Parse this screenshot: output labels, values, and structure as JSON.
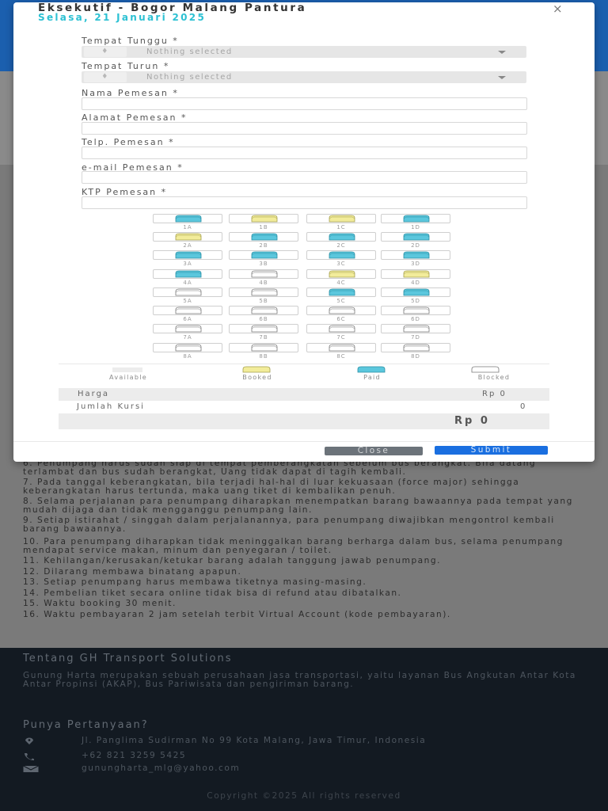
{
  "modal": {
    "title": "Eksekutif - Bogor Malang Pantura",
    "date": "Selasa, 21 Januari 2025",
    "close_icon": "×",
    "fields": {
      "pickup": {
        "label": "Tempat Tunggu *",
        "value": "Nothing selected"
      },
      "dropoff": {
        "label": "Tempat Turun *",
        "value": "Nothing selected"
      },
      "name": {
        "label": "Nama Pemesan *",
        "value": ""
      },
      "address": {
        "label": "Alamat Pemesan *",
        "value": ""
      },
      "phone": {
        "label": "Telp. Pemesan *",
        "value": ""
      },
      "email": {
        "label": "e-mail Pemesan *",
        "value": ""
      },
      "ktp": {
        "label": "KTP Pemesan *",
        "value": ""
      }
    },
    "seats": [
      {
        "id": "1A",
        "status": "paid"
      },
      {
        "id": "1B",
        "status": "booked"
      },
      {
        "id": "1C",
        "status": "booked"
      },
      {
        "id": "1D",
        "status": "paid"
      },
      {
        "id": "2A",
        "status": "booked"
      },
      {
        "id": "2B",
        "status": "paid"
      },
      {
        "id": "2C",
        "status": "paid"
      },
      {
        "id": "2D",
        "status": "paid"
      },
      {
        "id": "3A",
        "status": "paid"
      },
      {
        "id": "3B",
        "status": "paid"
      },
      {
        "id": "3C",
        "status": "paid"
      },
      {
        "id": "3D",
        "status": "paid"
      },
      {
        "id": "4A",
        "status": "paid"
      },
      {
        "id": "4B",
        "status": "available"
      },
      {
        "id": "4C",
        "status": "booked"
      },
      {
        "id": "4D",
        "status": "booked"
      },
      {
        "id": "5A",
        "status": "available"
      },
      {
        "id": "5B",
        "status": "available"
      },
      {
        "id": "5C",
        "status": "paid"
      },
      {
        "id": "5D",
        "status": "paid"
      },
      {
        "id": "6A",
        "status": "available"
      },
      {
        "id": "6B",
        "status": "available"
      },
      {
        "id": "6C",
        "status": "available"
      },
      {
        "id": "6D",
        "status": "available"
      },
      {
        "id": "7A",
        "status": "available"
      },
      {
        "id": "7B",
        "status": "available"
      },
      {
        "id": "7C",
        "status": "available"
      },
      {
        "id": "7D",
        "status": "available"
      },
      {
        "id": "8A",
        "status": "available"
      },
      {
        "id": "8B",
        "status": "available"
      },
      {
        "id": "8C",
        "status": "available"
      },
      {
        "id": "8D",
        "status": "available"
      }
    ],
    "legend": {
      "available": "Available",
      "booked": "Booked",
      "paid": "Paid",
      "blocked": "Blocked"
    },
    "colors": {
      "paid": "#5bc7dd",
      "booked": "#f2ec9a",
      "available": "#ffffff",
      "blocked": "#ffffff",
      "accent": "#1a6fe0",
      "date": "#2cc1d3"
    },
    "summary": {
      "price_label": "Harga",
      "price_value": "Rp 0",
      "seat_count_label": "Jumlah Kursi",
      "seat_count_value": "0",
      "total_value": "Rp 0"
    },
    "buttons": {
      "close": "Close",
      "submit": "Submit"
    }
  },
  "terms": [
    "6. Penumpang harus sudah siap di tempat pemberangkatan sebelum bus berangkat. Bila datang terlambat dan bus sudah berangkat, Uang tidak dapat di tagih kembali.",
    "7. Pada tanggal keberangkatan, bila terjadi hal-hal di luar kekuasaan (force major) sehingga keberangkatan harus tertunda, maka uang tiket di kembalikan penuh.",
    "8. Selama perjalanan para penumpang diharapkan menempatkan barang bawaannya pada tempat yang mudah dijaga dan tidak mengganggu penumpang lain.",
    "9. Setiap istirahat / singgah dalam perjalanannya, para penumpang diwajibkan mengontrol kembali barang bawaannya.",
    "10. Para penumpang diharapkan tidak meninggalkan barang berharga dalam bus, selama penumpang mendapat service makan, minum dan penyegaran / toilet.",
    "11. Kehilangan/kerusakan/ketukar barang adalah tanggung jawab penumpang.",
    "12. Dilarang membawa binatang apapun.",
    "13. Setiap penumpang harus membawa tiketnya masing-masing.",
    "14. Pembelian tiket secara online tidak bisa di refund atau dibatalkan.",
    "15. Waktu booking 30 menit.",
    "16. Waktu pembayaran 2 jam setelah terbit Virtual Account (kode pembayaran)."
  ],
  "footer": {
    "about_title": "Tentang GH Transport Solutions",
    "about_text": "Gunung Harta merupakan sebuah perusahaan jasa transportasi, yaitu layanan Bus Angkutan Antar Kota Antar Propinsi (AKAP), Bus Pariwisata dan pengiriman barang.",
    "question_title": "Punya Pertanyaan?",
    "address": "Jl. Panglima Sudirman No 99 Kota Malang, Jawa Timur, Indonesia",
    "phone": "+62 821 3259 5425",
    "email": "gunungharta_mlg@yahoo.com",
    "copyright": "Copyright ©2025 All rights reserved"
  }
}
